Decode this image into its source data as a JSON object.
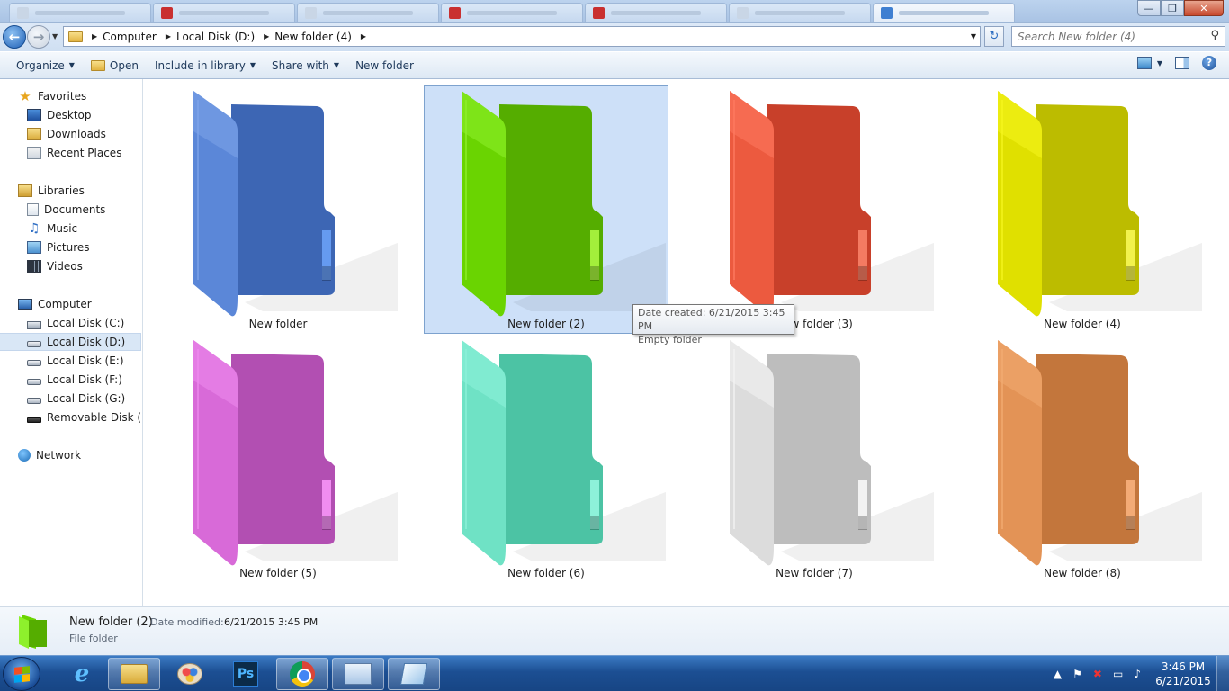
{
  "address_bar": {
    "breadcrumbs": [
      "Computer",
      "Local Disk (D:)",
      "New folder (4)"
    ],
    "search_placeholder": "Search New folder (4)"
  },
  "commands": {
    "organize": "Organize",
    "open": "Open",
    "include_in_library": "Include in library",
    "share_with": "Share with",
    "new_folder": "New folder"
  },
  "navigation": {
    "favorites": {
      "label": "Favorites",
      "items": [
        "Desktop",
        "Downloads",
        "Recent Places"
      ]
    },
    "libraries": {
      "label": "Libraries",
      "items": [
        "Documents",
        "Music",
        "Pictures",
        "Videos"
      ]
    },
    "computer": {
      "label": "Computer",
      "items": [
        "Local Disk (C:)",
        "Local Disk (D:)",
        "Local Disk (E:)",
        "Local Disk (F:)",
        "Local Disk (G:)",
        "Removable Disk (H:)"
      ],
      "selected": "Local Disk (D:)"
    },
    "network": {
      "label": "Network"
    }
  },
  "folders": [
    {
      "name": "New folder",
      "color": "#5b87d8",
      "shade": "#3d66b4",
      "light": "#7ea4ea",
      "accent": "#6fa8ff"
    },
    {
      "name": "New folder (2)",
      "color": "#6ad401",
      "shade": "#55ad00",
      "light": "#8ef02c",
      "accent": "#b6ff4a",
      "selected": true
    },
    {
      "name": "New folder (3)",
      "color": "#ec5a3f",
      "shade": "#c8402a",
      "light": "#ff7a60",
      "accent": "#ff8a70"
    },
    {
      "name": "New folder (4)",
      "color": "#e0e000",
      "shade": "#bcbc00",
      "light": "#f6f61e",
      "accent": "#ffff60"
    },
    {
      "name": "New folder (5)",
      "color": "#d86ad8",
      "shade": "#b24fb2",
      "light": "#ee8aee",
      "accent": "#ff9cff"
    },
    {
      "name": "New folder (6)",
      "color": "#6fe2c5",
      "shade": "#4cc3a4",
      "light": "#8ef2da",
      "accent": "#9dfde6"
    },
    {
      "name": "New folder (7)",
      "color": "#dcdcdc",
      "shade": "#bdbdbd",
      "light": "#f4f4f4",
      "accent": "#ffffff"
    },
    {
      "name": "New folder (8)",
      "color": "#e39356",
      "shade": "#c3763c",
      "light": "#f3ac72",
      "accent": "#ffb985"
    }
  ],
  "tooltip": {
    "line1": "Date created: 6/21/2015 3:45 PM",
    "line2": "Empty folder"
  },
  "details": {
    "name": "New folder (2)",
    "modified_label": "Date modified:",
    "modified_value": "6/21/2015 3:45 PM",
    "type": "File folder"
  },
  "taskbar": {
    "time": "3:46 PM",
    "date": "6/21/2015",
    "apps": [
      "internet-explorer",
      "windows-explorer",
      "paint",
      "photoshop",
      "chrome",
      "control-panel",
      "notepad"
    ],
    "ps_label": "Ps"
  }
}
